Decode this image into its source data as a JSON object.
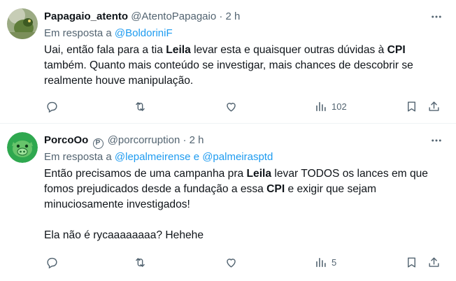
{
  "tweets": [
    {
      "name": "Papagaio_atento",
      "handle": "@AtentoPapagaio",
      "separator": "·",
      "time": "2 h",
      "verified_badge": "",
      "reply_prefix": "Em resposta a",
      "reply_to": [
        "@BoldoriniF"
      ],
      "reply_joiner": "",
      "text": {
        "p1_a": "Uai, então fala para a tia ",
        "p1_b": "Leila",
        "p1_c": " levar esta  e quaisquer outras dúvidas à ",
        "p1_d": "CPI",
        "p1_e": " também. Quanto mais conteúdo se investigar, mais chances de descobrir se realmente houve manipulação."
      },
      "actions": {
        "views": "102"
      }
    },
    {
      "name": "PorcoOo",
      "handle": "@porcorruption",
      "separator": "·",
      "time": "2 h",
      "verified_badge": "P",
      "reply_prefix": "Em resposta a",
      "reply_to": [
        "@lepalmeirense",
        "@palmeirasptd"
      ],
      "reply_joiner": "e",
      "text": {
        "p1_a": "Então precisamos de uma campanha pra ",
        "p1_b": "Leila",
        "p1_c": " levar TODOS os lances em que fomos prejudicados desde a fundação a essa ",
        "p1_d": "CPI",
        "p1_e": " e exigir que sejam minuciosamente investigados!",
        "p2": "Ela não é rycaaaaaaaa? Hehehe"
      },
      "actions": {
        "views": "5"
      }
    }
  ],
  "icons": [
    "more-icon",
    "reply-icon",
    "retweet-icon",
    "like-icon",
    "views-icon",
    "bookmark-icon",
    "share-icon"
  ],
  "colors": {
    "link": "#1d9bf0",
    "muted": "#536471",
    "text": "#0f1419",
    "divider": "#eff3f4"
  }
}
